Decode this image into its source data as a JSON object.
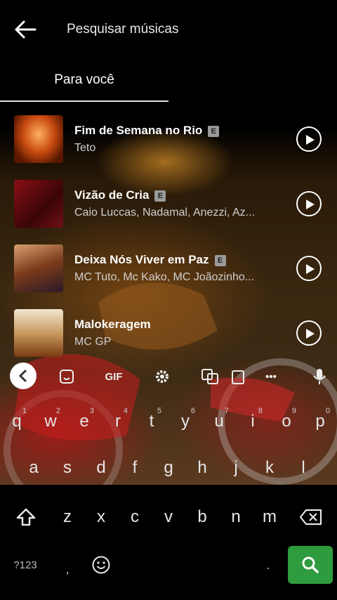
{
  "header": {
    "title": "Pesquisar músicas"
  },
  "tabs": [
    {
      "label": "Para você"
    }
  ],
  "songs": [
    {
      "title": "Fim de Semana no Rio",
      "artist": "Teto",
      "explicit": true
    },
    {
      "title": "Vizão de Cria",
      "artist": "Caio Luccas, Nadamal, Anezzi, Az...",
      "explicit": true
    },
    {
      "title": "Deixa Nós Viver em Paz",
      "artist": "MC Tuto, Mc Kako, MC Joãozinho...",
      "explicit": true
    },
    {
      "title": "Malokeragem",
      "artist": "MC GP",
      "explicit": false
    }
  ],
  "explicit_badge": "E",
  "toolbar": {
    "gif_label": "GIF",
    "more_label": "•••"
  },
  "keyboard": {
    "row1": [
      "q",
      "w",
      "e",
      "r",
      "t",
      "y",
      "u",
      "i",
      "o",
      "p"
    ],
    "row1_hints": [
      "1",
      "2",
      "3",
      "4",
      "5",
      "6",
      "7",
      "8",
      "9",
      "0"
    ],
    "row2": [
      "a",
      "s",
      "d",
      "f",
      "g",
      "h",
      "j",
      "k",
      "l"
    ],
    "row3": [
      "z",
      "x",
      "c",
      "v",
      "b",
      "n",
      "m"
    ],
    "symbols_label": "?123",
    "comma_label": ",",
    "period_label": "."
  },
  "colors": {
    "accent_green": "#2e9b3e"
  }
}
